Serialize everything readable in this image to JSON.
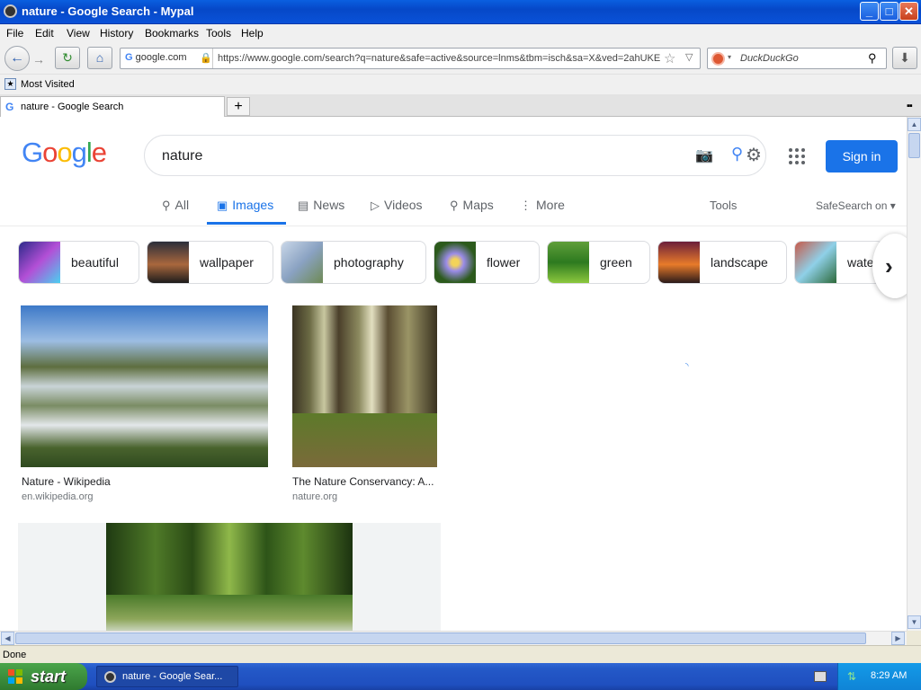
{
  "window": {
    "title": "nature - Google Search - Mypal",
    "controls": {
      "minimize": "_",
      "maximize": "□",
      "close": "✕"
    }
  },
  "menu": [
    "File",
    "Edit",
    "View",
    "History",
    "Bookmarks",
    "Tools",
    "Help"
  ],
  "nav": {
    "back_icon": "←",
    "forward_icon": "→",
    "reload_icon": "↻",
    "home_icon": "⌂",
    "url_site": "google.com",
    "url": "https://www.google.com/search?q=nature&safe=active&source=lnms&tbm=isch&sa=X&ved=2ahUKE",
    "search_placeholder": "DuckDuckGo",
    "download_icon": "⬇"
  },
  "bookmarks": {
    "most_visited": "Most Visited"
  },
  "tabs": [
    {
      "label": "nature - Google Search"
    }
  ],
  "google": {
    "logo_letters": [
      {
        "ch": "G",
        "color": "#4285f4"
      },
      {
        "ch": "o",
        "color": "#ea4335"
      },
      {
        "ch": "o",
        "color": "#fbbc05"
      },
      {
        "ch": "g",
        "color": "#4285f4"
      },
      {
        "ch": "l",
        "color": "#34a853"
      },
      {
        "ch": "e",
        "color": "#ea4335"
      }
    ],
    "query": "nature",
    "sign_in": "Sign in",
    "search_tabs": [
      {
        "label": "All",
        "icon": "search-icon",
        "active": false
      },
      {
        "label": "Images",
        "icon": "image-icon",
        "active": true
      },
      {
        "label": "News",
        "icon": "news-icon",
        "active": false
      },
      {
        "label": "Videos",
        "icon": "video-icon",
        "active": false
      },
      {
        "label": "Maps",
        "icon": "map-pin-icon",
        "active": false
      },
      {
        "label": "More",
        "icon": "more-vert-icon",
        "active": false
      }
    ],
    "tools": "Tools",
    "safesearch": "SafeSearch on",
    "chips": [
      "beautiful",
      "wallpaper",
      "photography",
      "flower",
      "green",
      "landscape",
      "wate"
    ],
    "results": [
      {
        "caption": "Nature - Wikipedia",
        "source": "en.wikipedia.org"
      },
      {
        "caption": "The Nature Conservancy: A...",
        "source": "nature.org"
      }
    ]
  },
  "status": "Done",
  "taskbar": {
    "start": "start",
    "task_item": "nature - Google Sear...",
    "time": "8:29 AM"
  },
  "colors": {
    "accent": "#1a73e8",
    "titlebar": "#0a52d8",
    "taskbar": "#2459c8",
    "start": "#3d8f3d"
  }
}
